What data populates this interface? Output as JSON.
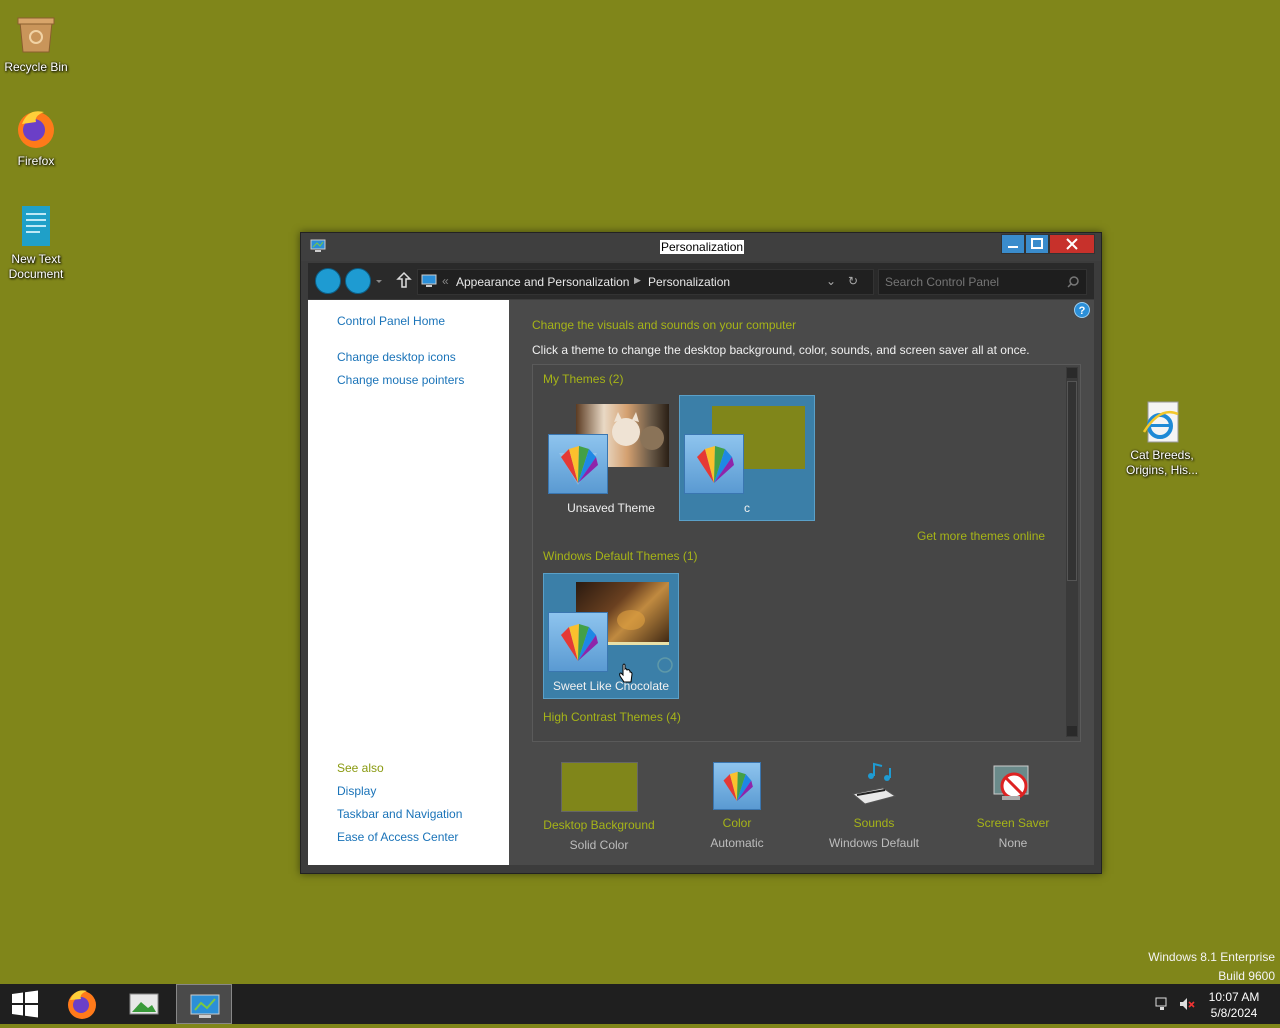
{
  "desktop": {
    "icons": [
      {
        "label": "Recycle Bin",
        "icon": "recycle-bin-icon"
      },
      {
        "label": "Firefox",
        "icon": "firefox-icon"
      },
      {
        "label": "New Text Document",
        "icon": "text-document-icon"
      },
      {
        "label": "Cat Breeds, Origins, His...",
        "icon": "internet-explorer-icon"
      }
    ],
    "background_color": "#80861a"
  },
  "window": {
    "title": "Personalization",
    "breadcrumb": {
      "separator": "«",
      "items": [
        "Appearance and Personalization",
        "Personalization"
      ]
    },
    "search_placeholder": "Search Control Panel",
    "left_pane": {
      "home_link": "Control Panel Home",
      "links": [
        "Change desktop icons",
        "Change mouse pointers"
      ],
      "see_also_title": "See also",
      "see_also_links": [
        "Display",
        "Taskbar and Navigation",
        "Ease of Access Center"
      ]
    },
    "main": {
      "heading": "Change the visuals and sounds on your computer",
      "subheading": "Click a theme to change the desktop background, color, sounds, and screen saver all at once.",
      "my_themes_title": "My Themes (2)",
      "my_themes": [
        {
          "label": "Unsaved Theme",
          "selected": false
        },
        {
          "label": "c",
          "selected": true
        }
      ],
      "get_more_link": "Get more themes online",
      "default_themes_title": "Windows Default Themes (1)",
      "default_themes": [
        {
          "label": "Sweet Like Chocolate",
          "selected": true
        }
      ],
      "high_contrast_title": "High Contrast Themes (4)"
    },
    "bottom_items": [
      {
        "title": "Desktop Background",
        "value": "Solid Color",
        "icon": "solid-color-swatch-icon"
      },
      {
        "title": "Color",
        "value": "Automatic",
        "icon": "color-palette-icon"
      },
      {
        "title": "Sounds",
        "value": "Windows Default",
        "icon": "sounds-icon"
      },
      {
        "title": "Screen Saver",
        "value": "None",
        "icon": "screen-saver-icon"
      }
    ]
  },
  "watermark": {
    "line1": "Windows 8.1 Enterprise",
    "line2": "Build 9600"
  },
  "taskbar": {
    "time": "10:07 AM",
    "date": "5/8/2024"
  }
}
